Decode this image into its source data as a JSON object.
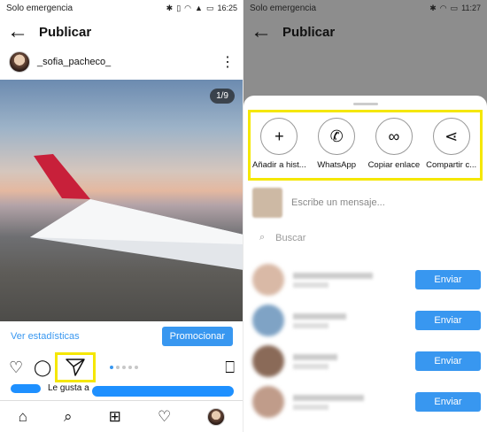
{
  "left": {
    "status": {
      "carrier": "Solo emergencia",
      "time": "16:25"
    },
    "header": {
      "back_icon": "arrow-left-icon",
      "title": "Publicar"
    },
    "user": {
      "username": "_sofia_pacheco_"
    },
    "photo": {
      "counter": "1/9"
    },
    "stats": {
      "link": "Ver estadísticas",
      "promote": "Promocionar"
    },
    "likes": {
      "text": "Le gusta a"
    },
    "carousel": {
      "current_index": 0,
      "dot_count": 5
    }
  },
  "right": {
    "status": {
      "carrier": "Solo emergencia",
      "time": "11:27"
    },
    "header": {
      "title": "Publicar"
    },
    "share_options": [
      {
        "icon": "plus-icon",
        "label": "Añadir a hist..."
      },
      {
        "icon": "whatsapp-icon",
        "label": "WhatsApp"
      },
      {
        "icon": "link-icon",
        "label": "Copiar enlace"
      },
      {
        "icon": "share-icon",
        "label": "Compartir c..."
      }
    ],
    "message_placeholder": "Escribe un mensaje...",
    "search_placeholder": "Buscar",
    "send_label": "Enviar"
  },
  "colors": {
    "accent": "#3897f0",
    "highlight": "#f5e700"
  }
}
